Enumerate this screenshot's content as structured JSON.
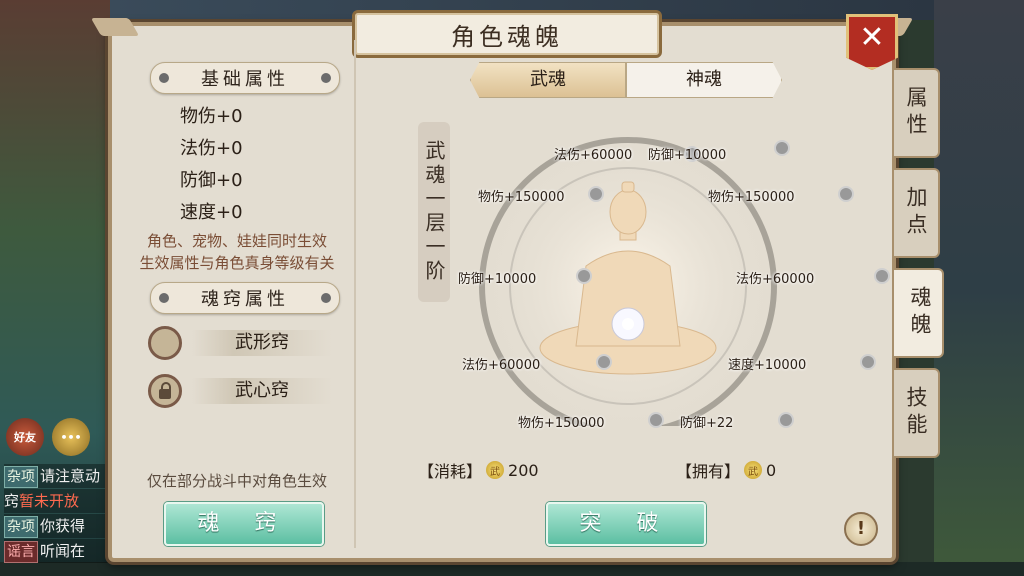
{
  "title": "角色魂魄",
  "close_label": "✕",
  "left": {
    "base_attr_header": "基础属性",
    "stats": [
      "物伤+0",
      "法伤+0",
      "防御+0",
      "速度+0"
    ],
    "note": "角色、宠物、娃娃同时生效生效属性与角色真身等级有关",
    "note_line1": "角色、宠物、娃娃同时生效",
    "note_line2": "生效属性与角色真身等级有关",
    "qiao_header": "魂窍属性",
    "qiao_items": [
      {
        "label": "武形窍",
        "locked": false
      },
      {
        "label": "武心窍",
        "locked": true
      }
    ],
    "battle_note": "仅在部分战斗中对角色生效",
    "hunqiao_button": "魂 窍"
  },
  "tabs": [
    "武魂",
    "神魂"
  ],
  "active_tab": 0,
  "stage_label": "武魂一层一阶",
  "ring_attrs": [
    "法伤+60000",
    "防御+10000",
    "物伤+150000",
    "物伤+150000",
    "防御+10000",
    "法伤+60000",
    "法伤+60000",
    "速度+10000",
    "物伤+150000",
    "防御+22"
  ],
  "cost": {
    "label": "【消耗】",
    "coin_icon": "武",
    "value": "200"
  },
  "owned": {
    "label": "【拥有】",
    "coin_icon": "武",
    "value": "0"
  },
  "breakthrough_button": "突 破",
  "help_label": "!",
  "side_tabs": [
    "属性",
    "加点",
    "魂魄",
    "技能"
  ],
  "active_side_tab": 2,
  "chat": {
    "friends_label": "好友",
    "lines": [
      {
        "tag": "杂项",
        "text": "请注意动"
      },
      {
        "tag": "",
        "text": "窍",
        "highlight": "暂未开放"
      },
      {
        "tag": "杂项",
        "text": "你获得"
      },
      {
        "tag": "谣言",
        "text": "听闻在"
      }
    ]
  },
  "colors": {
    "accent_green": "#5cbfa2",
    "close_red": "#b32d22",
    "note_brown": "#7a4d35"
  }
}
